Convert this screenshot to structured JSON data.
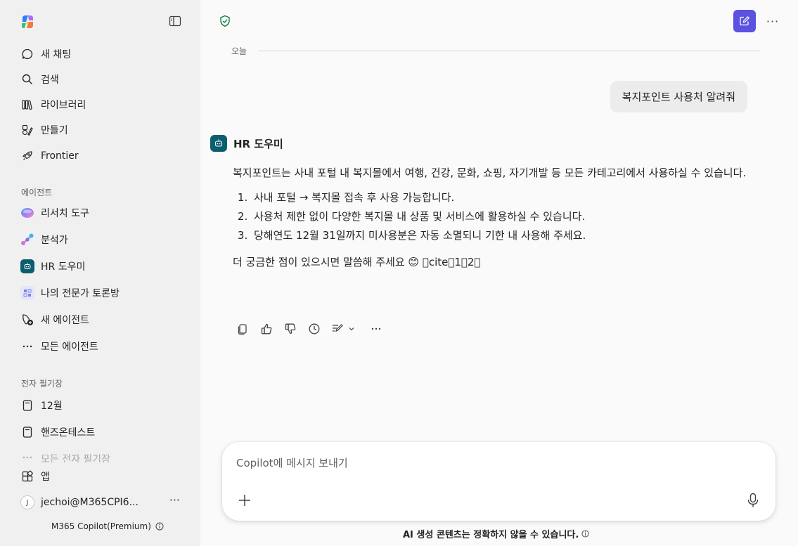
{
  "sidebar": {
    "nav": [
      {
        "label": "새 채팅",
        "icon": "chat-icon"
      },
      {
        "label": "검색",
        "icon": "search-icon"
      },
      {
        "label": "라이브러리",
        "icon": "library-icon"
      },
      {
        "label": "만들기",
        "icon": "create-icon"
      },
      {
        "label": "Frontier",
        "icon": "rocket-icon"
      }
    ],
    "agents_label": "에이전트",
    "agents": [
      {
        "label": "리서치 도구",
        "icon": "researcher-icon"
      },
      {
        "label": "분석가",
        "icon": "analyst-icon"
      },
      {
        "label": "HR 도우미",
        "icon": "hr-bot-icon"
      },
      {
        "label": "나의 전문가 토론방",
        "icon": "expert-icon"
      },
      {
        "label": "새 에이전트",
        "icon": "new-agent-icon"
      },
      {
        "label": "모든 에이전트",
        "icon": "more-icon"
      }
    ],
    "notebooks_label": "전자 필기장",
    "notebooks": [
      {
        "label": "12월",
        "icon": "notebook-icon"
      },
      {
        "label": "핸즈온테스트",
        "icon": "notebook-icon"
      },
      {
        "label": "모든 전자 필기장",
        "icon": "more-icon"
      }
    ],
    "apps_label": "앱",
    "user": {
      "initial": "J",
      "email": "jechoi@M365CPI6...",
      "more": "···"
    },
    "plan": "M365 Copilot(Premium)"
  },
  "header": {
    "more": "···"
  },
  "conversation": {
    "date": "오늘",
    "user_message": "복지포인트 사용처 알려줘",
    "bot_name": "HR 도우미",
    "intro": "복지포인트는 사내 포털 내 복지몰에서 여행, 건강, 문화, 쇼핑, 자기개발 등 모든 카테고리에서 사용하실 수 있습니다.",
    "steps": [
      "사내 포털 → 복지몰 접속 후 사용 가능합니다.",
      "사용처 제한 없이 다양한 복지몰 내 상품 및 서비스에 활용하실 수 있습니다.",
      "당해연도 12월 31일까지 미사용분은 자동 소멸되니 기한 내 사용해 주세요."
    ],
    "closing": "더 궁금한 점이 있으시면 말씀해 주세요 😊 cite12"
  },
  "composer": {
    "placeholder": "Copilot에 메시지 보내기"
  },
  "disclaimer": "AI 생성 콘텐츠는 정확하지 않을 수 있습니다.",
  "colors": {
    "accent": "#5b52e0",
    "sidebar_bg": "#f0f0f0",
    "main_bg": "#fafafa",
    "bot_icon": "#0b5e6e"
  }
}
